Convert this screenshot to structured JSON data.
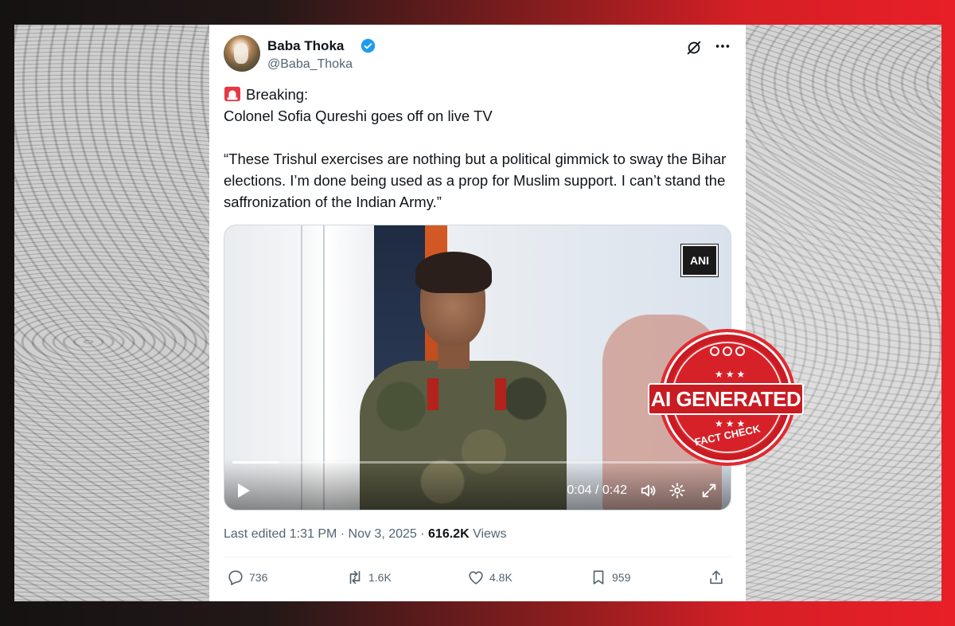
{
  "tweet": {
    "author_name": "Baba Thoka",
    "author_handle": "@Baba_Thoka",
    "line1": "Breaking:",
    "line2": "Colonel Sofia Qureshi goes off on live TV",
    "quote": "“These Trishul exercises are nothing but a political gimmick to sway the Bihar elections. I’m done being used as a prop for Muslim support. I can’t stand the saffronization of the Indian Army.”",
    "meta_prefix": "Last edited 1:31 PM · Nov 3, 2025 · ",
    "views_count": "616.2K",
    "views_label": " Views"
  },
  "video": {
    "channel_logo": "ANI",
    "time": "0:04 / 0:42",
    "progress": 0.095
  },
  "actions": {
    "replies": "736",
    "reposts": "1.6K",
    "likes": "4.8K",
    "bookmarks": "959"
  },
  "stamp": {
    "main": "AI GENERATED",
    "stars": "★★★",
    "bottom": "FACT CHECK"
  },
  "colors": {
    "verified": "#1d9bf0",
    "stamp_red": "#d62128"
  },
  "icons": [
    "verified-badge-icon",
    "grok-icon",
    "more-icon",
    "siren-icon",
    "play-icon",
    "volume-icon",
    "settings-icon",
    "fullscreen-icon",
    "reply-icon",
    "repost-icon",
    "like-icon",
    "bookmark-icon",
    "share-icon"
  ]
}
